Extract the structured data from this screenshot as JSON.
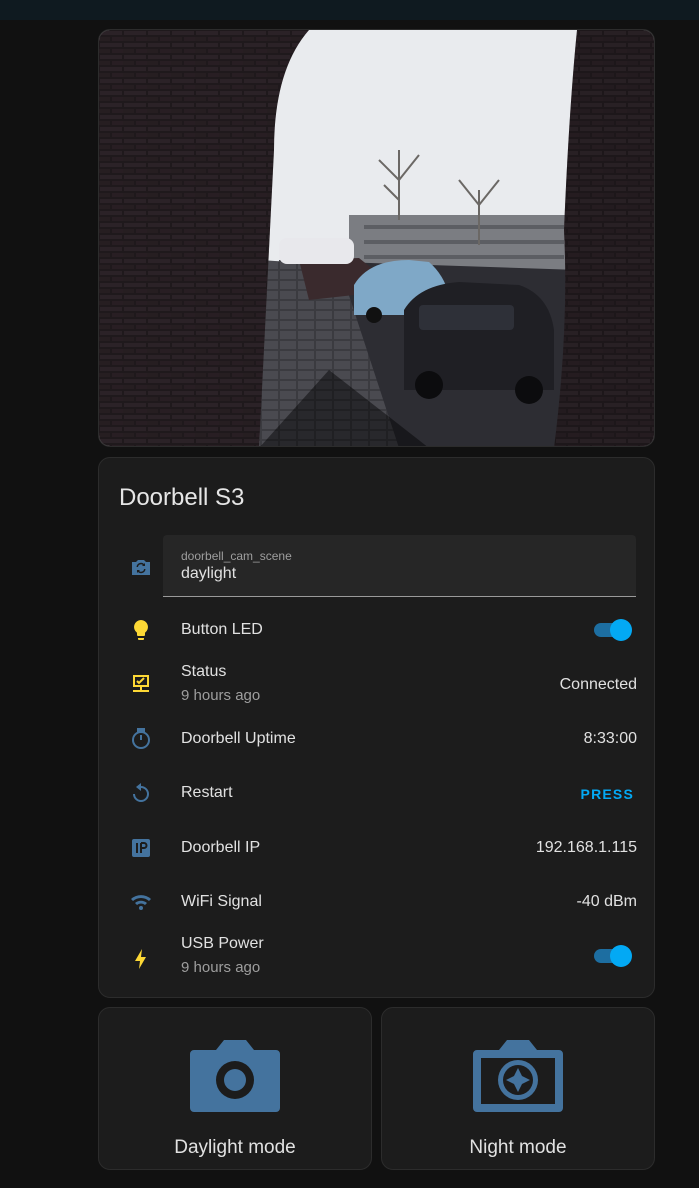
{
  "colors": {
    "accent": "#03a9f4",
    "icon_blue": "#44739e",
    "icon_yellow": "#fdd835",
    "background": "#111111",
    "card": "#1c1c1c"
  },
  "camera": {
    "image_alt": "Doorbell camera live view"
  },
  "entities_card": {
    "title": "Doorbell S3",
    "scene_select": {
      "icon": "camera-switch-icon",
      "caption": "doorbell_cam_scene",
      "value": "daylight"
    },
    "rows": [
      {
        "icon": "lightbulb-icon",
        "label": "Button LED",
        "state": "on"
      },
      {
        "icon": "monitor-network-icon",
        "label": "Status",
        "secondary": "9 hours ago",
        "value": "Connected"
      },
      {
        "icon": "timer-icon",
        "label": "Doorbell Uptime",
        "value": "8:33:00"
      },
      {
        "icon": "restart-icon",
        "label": "Restart",
        "action": "PRESS"
      },
      {
        "icon": "ip-icon",
        "label": "Doorbell IP",
        "value": "192.168.1.115"
      },
      {
        "icon": "wifi-icon",
        "label": "WiFi Signal",
        "value": "-40 dBm"
      },
      {
        "icon": "flash-icon",
        "label": "USB Power",
        "secondary": "9 hours ago",
        "state": "on"
      }
    ]
  },
  "buttons": [
    {
      "icon": "camera-icon",
      "label": "Daylight mode"
    },
    {
      "icon": "camera-iris-icon",
      "label": "Night mode"
    }
  ]
}
